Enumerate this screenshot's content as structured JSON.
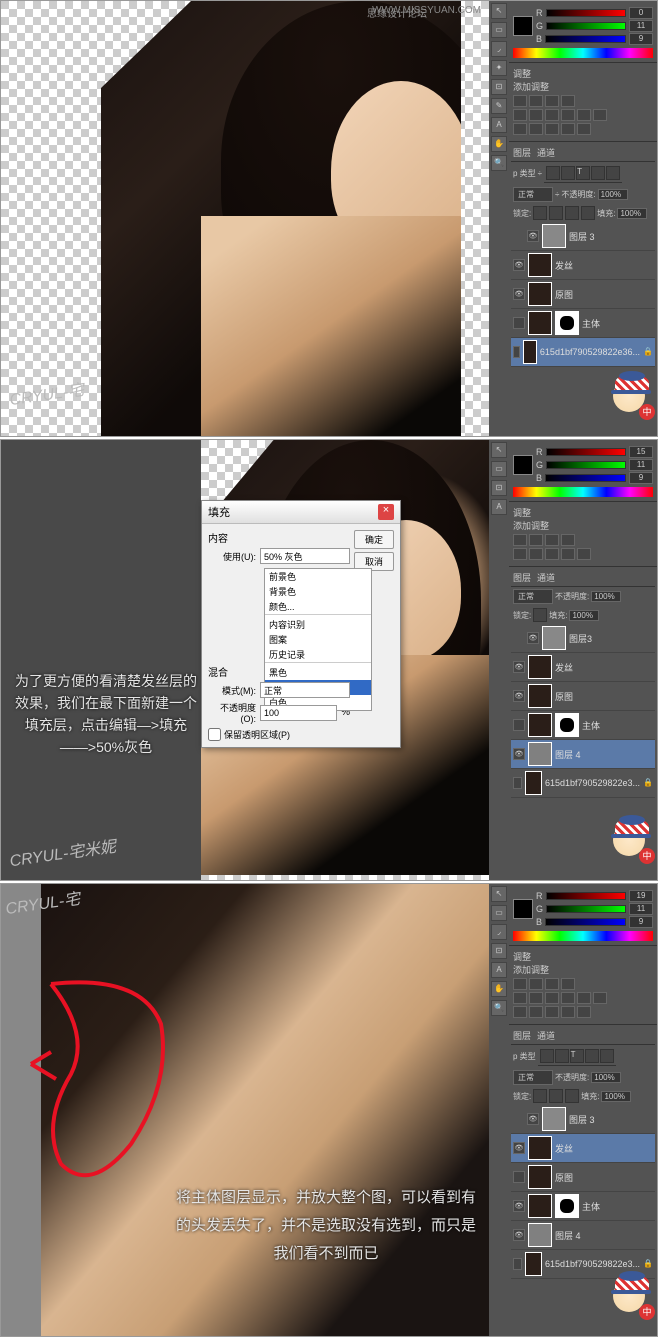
{
  "watermark_site": "思缘设计论坛",
  "watermark_url": "WWW.MISSYUAN.COM",
  "signature": "CRYUL-宅米妮",
  "signature_short": "CRYUL-宅",
  "mascot_badge": "中",
  "color": {
    "r_label": "R",
    "g_label": "G",
    "b_label": "B",
    "r_val1": "0",
    "g_val1": "11",
    "b_val1": "9",
    "r_val2": "15",
    "g_val2": "11",
    "b_val2": "9",
    "r_val3": "19",
    "g_val3": "11",
    "b_val3": "9"
  },
  "adjustments": {
    "title": "调整",
    "add_label": "添加调整"
  },
  "layers": {
    "tab_layers": "图层",
    "tab_channels": "通道",
    "kind_label": "p 类型",
    "blend_mode": "正常",
    "opacity_label": "不透明度:",
    "opacity_val": "100%",
    "lock_label": "锁定:",
    "fill_label": "填充:",
    "fill_val": "100%",
    "items1": [
      {
        "name": "图层 3"
      },
      {
        "name": "发丝"
      },
      {
        "name": "原图"
      },
      {
        "name": "主体"
      },
      {
        "name": "615d1bf790529822e36..."
      }
    ],
    "items2": [
      {
        "name": "图层3"
      },
      {
        "name": "发丝"
      },
      {
        "name": "原图"
      },
      {
        "name": "主体"
      },
      {
        "name": "图层 4"
      },
      {
        "name": "615d1bf790529822e3..."
      }
    ],
    "items3": [
      {
        "name": "图层 3"
      },
      {
        "name": "发丝"
      },
      {
        "name": "原图"
      },
      {
        "name": "主体"
      },
      {
        "name": "图层 4"
      },
      {
        "name": "615d1bf790529822e3..."
      }
    ]
  },
  "dialog": {
    "title": "填充",
    "content_label": "内容",
    "use_label": "使用(U):",
    "use_value": "50% 灰色",
    "options": [
      "前景色",
      "背景色",
      "颜色...",
      "",
      "内容识别",
      "图案",
      "历史记录",
      "",
      "黑色",
      "50% 灰色",
      "白色"
    ],
    "blend_section": "混合",
    "mode_label": "模式(M):",
    "mode_value": "正常",
    "opacity_label": "不透明度(O):",
    "opacity_value": "100",
    "pct": "%",
    "preserve": "保留透明区域(P)",
    "ok": "确定",
    "cancel": "取消"
  },
  "text_panel2": "为了更方便的看清楚发丝层的效果，我们在最下面新建一个填充层，点击编辑—>填充——>50%灰色",
  "text_panel3": "将主体图层显示，并放大整个图，可以看到有的头发丢失了，并不是选取没有选到，而只是我们看不到而已"
}
